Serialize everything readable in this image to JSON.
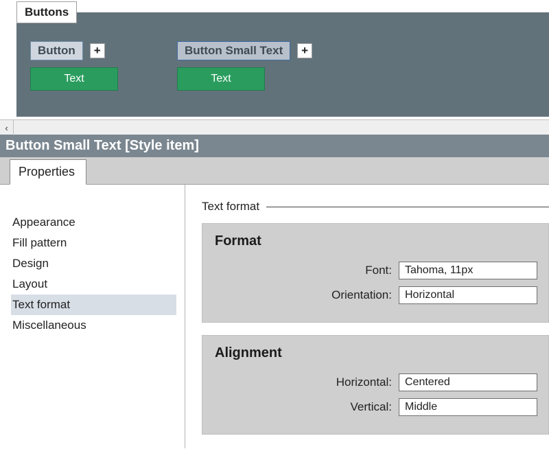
{
  "canvas": {
    "panel_tab": "Buttons",
    "items": [
      {
        "name": "Button",
        "sample_text": "Text"
      },
      {
        "name": "Button Small Text",
        "sample_text": "Text"
      }
    ],
    "plus_label": "+",
    "scroll_left_glyph": "‹"
  },
  "item_header": "Button Small Text [Style item]",
  "tabs": {
    "properties": "Properties"
  },
  "sidebar": {
    "items": [
      "Appearance",
      "Fill pattern",
      "Design",
      "Layout",
      "Text format",
      "Miscellaneous"
    ],
    "selected_index": 4
  },
  "section": {
    "title": "Text format",
    "groups": {
      "format": {
        "title": "Format",
        "fields": {
          "font_label": "Font:",
          "font_value": "Tahoma, 11px",
          "orientation_label": "Orientation:",
          "orientation_value": "Horizontal"
        }
      },
      "alignment": {
        "title": "Alignment",
        "fields": {
          "horizontal_label": "Horizontal:",
          "horizontal_value": "Centered",
          "vertical_label": "Vertical:",
          "vertical_value": "Middle"
        }
      }
    }
  }
}
